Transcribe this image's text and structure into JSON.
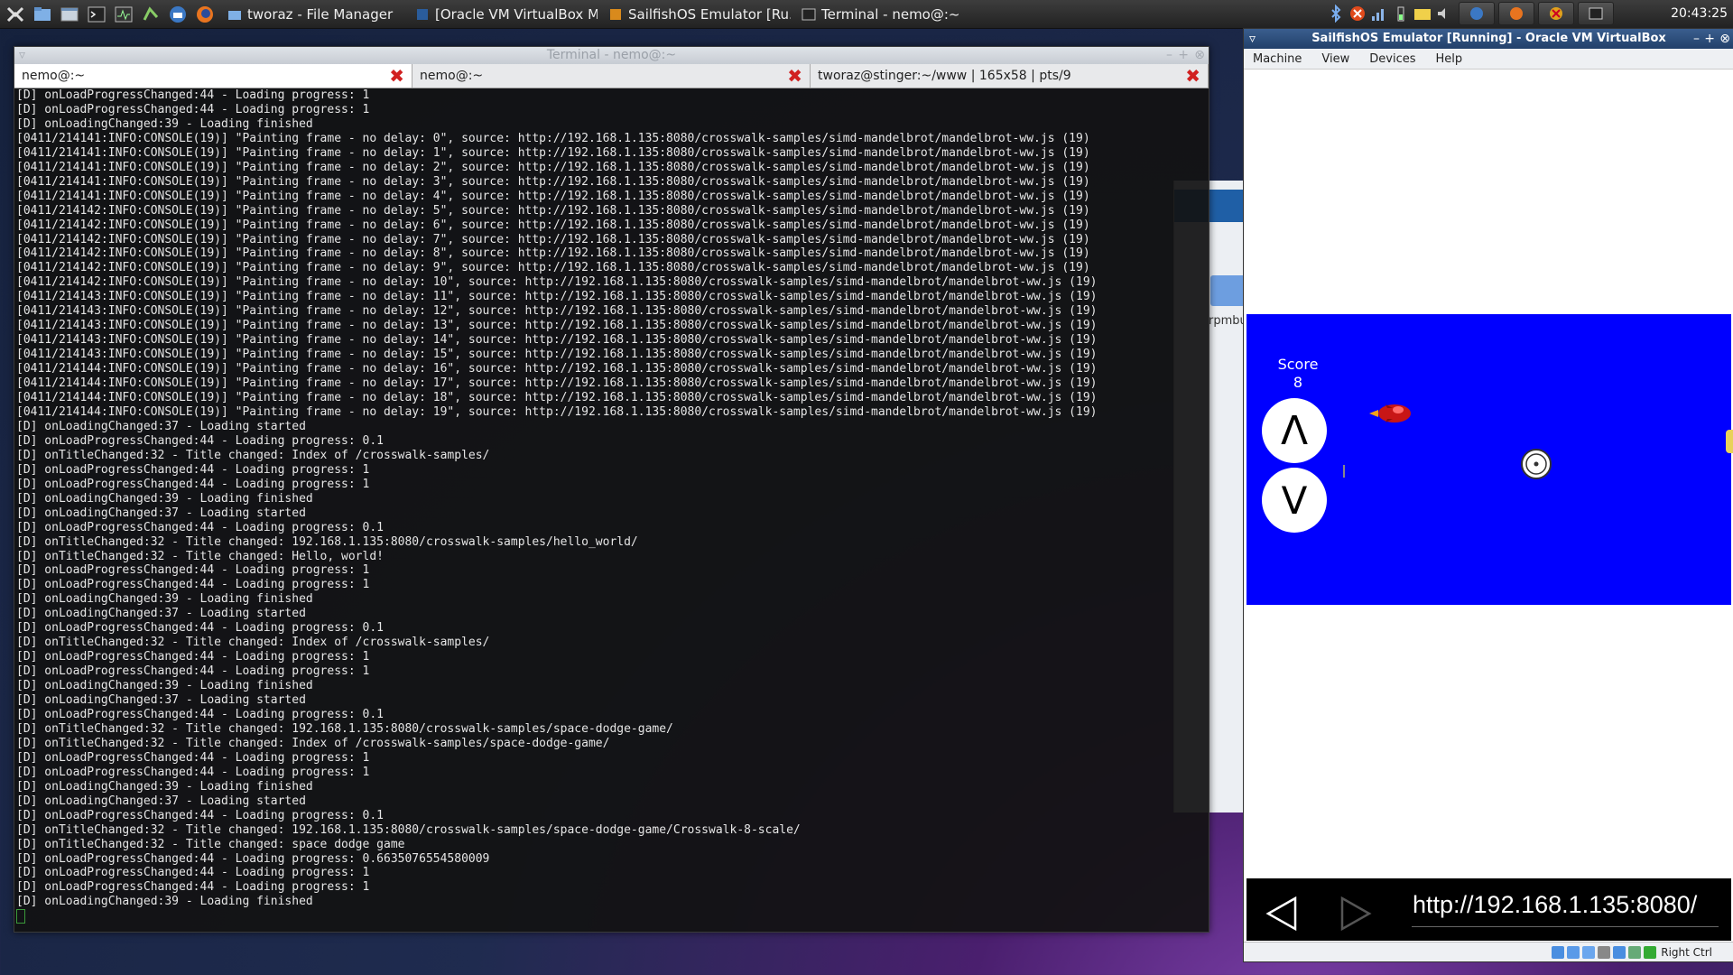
{
  "taskbar": {
    "launchers": [
      "file-manager-icon",
      "window-icon",
      "terminal-icon",
      "system-monitor-icon",
      "task-manager-icon",
      "thunderbird-icon",
      "firefox-icon"
    ],
    "tasks": [
      {
        "label": "tworaz - File Manager",
        "icon": "folder-icon"
      },
      {
        "label": "[Oracle VM VirtualBox M...",
        "icon": "virtualbox-icon"
      },
      {
        "label": "SailfishOS Emulator [Ru...",
        "icon": "virtualbox-icon"
      },
      {
        "label": "Terminal - nemo@:~",
        "icon": "terminal-icon"
      }
    ],
    "clock": "20:43:25"
  },
  "background_window": {
    "partial_label": "rpmbu"
  },
  "terminal": {
    "title": "Terminal - nemo@:~",
    "tabs": [
      {
        "label": "nemo@:~",
        "active": true
      },
      {
        "label": "nemo@:~",
        "active": false
      },
      {
        "label": "tworaz@stinger:~/www | 165x58 | pts/9",
        "active": false
      }
    ],
    "lines": [
      "[D] onLoadProgressChanged:44 - Loading progress: 1",
      "[D] onLoadProgressChanged:44 - Loading progress: 1",
      "[D] onLoadingChanged:39 - Loading finished",
      "[0411/214141:INFO:CONSOLE(19)] \"Painting frame - no delay: 0\", source: http://192.168.1.135:8080/crosswalk-samples/simd-mandelbrot/mandelbrot-ww.js (19)",
      "[0411/214141:INFO:CONSOLE(19)] \"Painting frame - no delay: 1\", source: http://192.168.1.135:8080/crosswalk-samples/simd-mandelbrot/mandelbrot-ww.js (19)",
      "[0411/214141:INFO:CONSOLE(19)] \"Painting frame - no delay: 2\", source: http://192.168.1.135:8080/crosswalk-samples/simd-mandelbrot/mandelbrot-ww.js (19)",
      "[0411/214141:INFO:CONSOLE(19)] \"Painting frame - no delay: 3\", source: http://192.168.1.135:8080/crosswalk-samples/simd-mandelbrot/mandelbrot-ww.js (19)",
      "[0411/214141:INFO:CONSOLE(19)] \"Painting frame - no delay: 4\", source: http://192.168.1.135:8080/crosswalk-samples/simd-mandelbrot/mandelbrot-ww.js (19)",
      "[0411/214142:INFO:CONSOLE(19)] \"Painting frame - no delay: 5\", source: http://192.168.1.135:8080/crosswalk-samples/simd-mandelbrot/mandelbrot-ww.js (19)",
      "[0411/214142:INFO:CONSOLE(19)] \"Painting frame - no delay: 6\", source: http://192.168.1.135:8080/crosswalk-samples/simd-mandelbrot/mandelbrot-ww.js (19)",
      "[0411/214142:INFO:CONSOLE(19)] \"Painting frame - no delay: 7\", source: http://192.168.1.135:8080/crosswalk-samples/simd-mandelbrot/mandelbrot-ww.js (19)",
      "[0411/214142:INFO:CONSOLE(19)] \"Painting frame - no delay: 8\", source: http://192.168.1.135:8080/crosswalk-samples/simd-mandelbrot/mandelbrot-ww.js (19)",
      "[0411/214142:INFO:CONSOLE(19)] \"Painting frame - no delay: 9\", source: http://192.168.1.135:8080/crosswalk-samples/simd-mandelbrot/mandelbrot-ww.js (19)",
      "[0411/214142:INFO:CONSOLE(19)] \"Painting frame - no delay: 10\", source: http://192.168.1.135:8080/crosswalk-samples/simd-mandelbrot/mandelbrot-ww.js (19)",
      "[0411/214143:INFO:CONSOLE(19)] \"Painting frame - no delay: 11\", source: http://192.168.1.135:8080/crosswalk-samples/simd-mandelbrot/mandelbrot-ww.js (19)",
      "[0411/214143:INFO:CONSOLE(19)] \"Painting frame - no delay: 12\", source: http://192.168.1.135:8080/crosswalk-samples/simd-mandelbrot/mandelbrot-ww.js (19)",
      "[0411/214143:INFO:CONSOLE(19)] \"Painting frame - no delay: 13\", source: http://192.168.1.135:8080/crosswalk-samples/simd-mandelbrot/mandelbrot-ww.js (19)",
      "[0411/214143:INFO:CONSOLE(19)] \"Painting frame - no delay: 14\", source: http://192.168.1.135:8080/crosswalk-samples/simd-mandelbrot/mandelbrot-ww.js (19)",
      "[0411/214143:INFO:CONSOLE(19)] \"Painting frame - no delay: 15\", source: http://192.168.1.135:8080/crosswalk-samples/simd-mandelbrot/mandelbrot-ww.js (19)",
      "[0411/214144:INFO:CONSOLE(19)] \"Painting frame - no delay: 16\", source: http://192.168.1.135:8080/crosswalk-samples/simd-mandelbrot/mandelbrot-ww.js (19)",
      "[0411/214144:INFO:CONSOLE(19)] \"Painting frame - no delay: 17\", source: http://192.168.1.135:8080/crosswalk-samples/simd-mandelbrot/mandelbrot-ww.js (19)",
      "[0411/214144:INFO:CONSOLE(19)] \"Painting frame - no delay: 18\", source: http://192.168.1.135:8080/crosswalk-samples/simd-mandelbrot/mandelbrot-ww.js (19)",
      "[0411/214144:INFO:CONSOLE(19)] \"Painting frame - no delay: 19\", source: http://192.168.1.135:8080/crosswalk-samples/simd-mandelbrot/mandelbrot-ww.js (19)",
      "[D] onLoadingChanged:37 - Loading started",
      "[D] onLoadProgressChanged:44 - Loading progress: 0.1",
      "[D] onTitleChanged:32 - Title changed: Index of /crosswalk-samples/",
      "[D] onLoadProgressChanged:44 - Loading progress: 1",
      "[D] onLoadProgressChanged:44 - Loading progress: 1",
      "[D] onLoadingChanged:39 - Loading finished",
      "[D] onLoadingChanged:37 - Loading started",
      "[D] onLoadProgressChanged:44 - Loading progress: 0.1",
      "[D] onTitleChanged:32 - Title changed: 192.168.1.135:8080/crosswalk-samples/hello_world/",
      "[D] onTitleChanged:32 - Title changed: Hello, world!",
      "[D] onLoadProgressChanged:44 - Loading progress: 1",
      "[D] onLoadProgressChanged:44 - Loading progress: 1",
      "[D] onLoadingChanged:39 - Loading finished",
      "[D] onLoadingChanged:37 - Loading started",
      "[D] onLoadProgressChanged:44 - Loading progress: 0.1",
      "[D] onTitleChanged:32 - Title changed: Index of /crosswalk-samples/",
      "[D] onLoadProgressChanged:44 - Loading progress: 1",
      "[D] onLoadProgressChanged:44 - Loading progress: 1",
      "[D] onLoadingChanged:39 - Loading finished",
      "[D] onLoadingChanged:37 - Loading started",
      "[D] onLoadProgressChanged:44 - Loading progress: 0.1",
      "[D] onTitleChanged:32 - Title changed: 192.168.1.135:8080/crosswalk-samples/space-dodge-game/",
      "[D] onTitleChanged:32 - Title changed: Index of /crosswalk-samples/space-dodge-game/",
      "[D] onLoadProgressChanged:44 - Loading progress: 1",
      "[D] onLoadProgressChanged:44 - Loading progress: 1",
      "[D] onLoadingChanged:39 - Loading finished",
      "[D] onLoadingChanged:37 - Loading started",
      "[D] onLoadProgressChanged:44 - Loading progress: 0.1",
      "[D] onTitleChanged:32 - Title changed: 192.168.1.135:8080/crosswalk-samples/space-dodge-game/Crosswalk-8-scale/",
      "[D] onTitleChanged:32 - Title changed: space dodge game",
      "[D] onLoadProgressChanged:44 - Loading progress: 0.6635076554580009",
      "[D] onLoadProgressChanged:44 - Loading progress: 1",
      "[D] onLoadProgressChanged:44 - Loading progress: 1",
      "[D] onLoadingChanged:39 - Loading finished"
    ]
  },
  "vbox": {
    "title": "SailfishOS Emulator [Running] - Oracle VM VirtualBox",
    "menu": [
      "Machine",
      "View",
      "Devices",
      "Help"
    ],
    "game": {
      "score_label": "Score",
      "score_value": "8",
      "up_label": "Λ",
      "down_label": "V"
    },
    "browser": {
      "url": "http://192.168.1.135:8080/"
    },
    "status_host_key": "Right Ctrl"
  },
  "colors": {
    "game_bg": "#0000ff",
    "terminal_bg": "#121212",
    "vbox_title": "#2b4b78"
  }
}
